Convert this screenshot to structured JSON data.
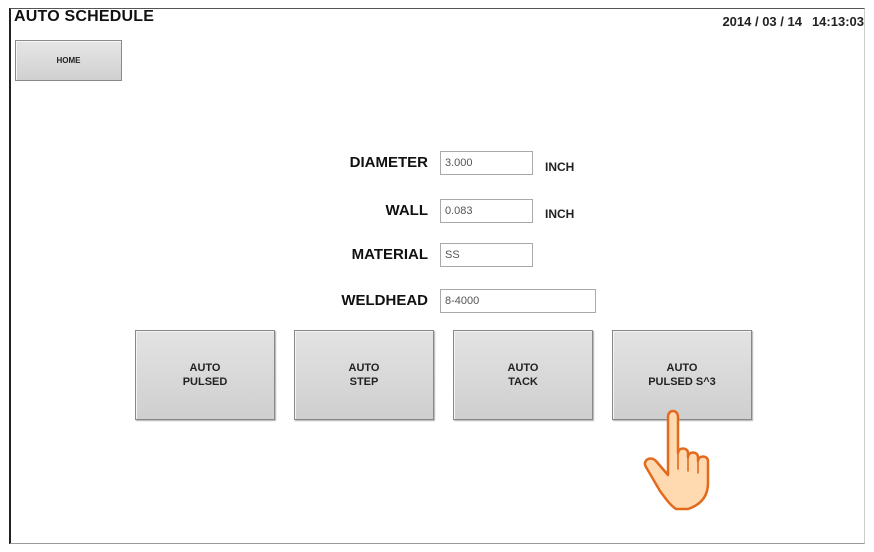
{
  "header": {
    "title": "AUTO SCHEDULE",
    "date": "2014 / 03 / 14",
    "time": "14:13:03"
  },
  "nav": {
    "home_label": "HOME"
  },
  "form": {
    "diameter": {
      "label": "DIAMETER",
      "value": "3.000",
      "unit": "INCH"
    },
    "wall": {
      "label": "WALL",
      "value": "0.083",
      "unit": "INCH"
    },
    "material": {
      "label": "MATERIAL",
      "value": "SS"
    },
    "weldhead": {
      "label": "WELDHEAD",
      "value": "8-4000"
    }
  },
  "modes": [
    {
      "line1": "AUTO",
      "line2": "PULSED"
    },
    {
      "line1": "AUTO",
      "line2": "STEP"
    },
    {
      "line1": "AUTO",
      "line2": "TACK"
    },
    {
      "line1": "AUTO",
      "line2": "PULSED S^3"
    }
  ],
  "icons": {
    "cursor": "pointing-hand-icon"
  },
  "colors": {
    "button_face": "#d9d9d9",
    "button_border": "#888888",
    "hand_skin": "#ffd9b0",
    "hand_outline": "#e36a1c"
  }
}
